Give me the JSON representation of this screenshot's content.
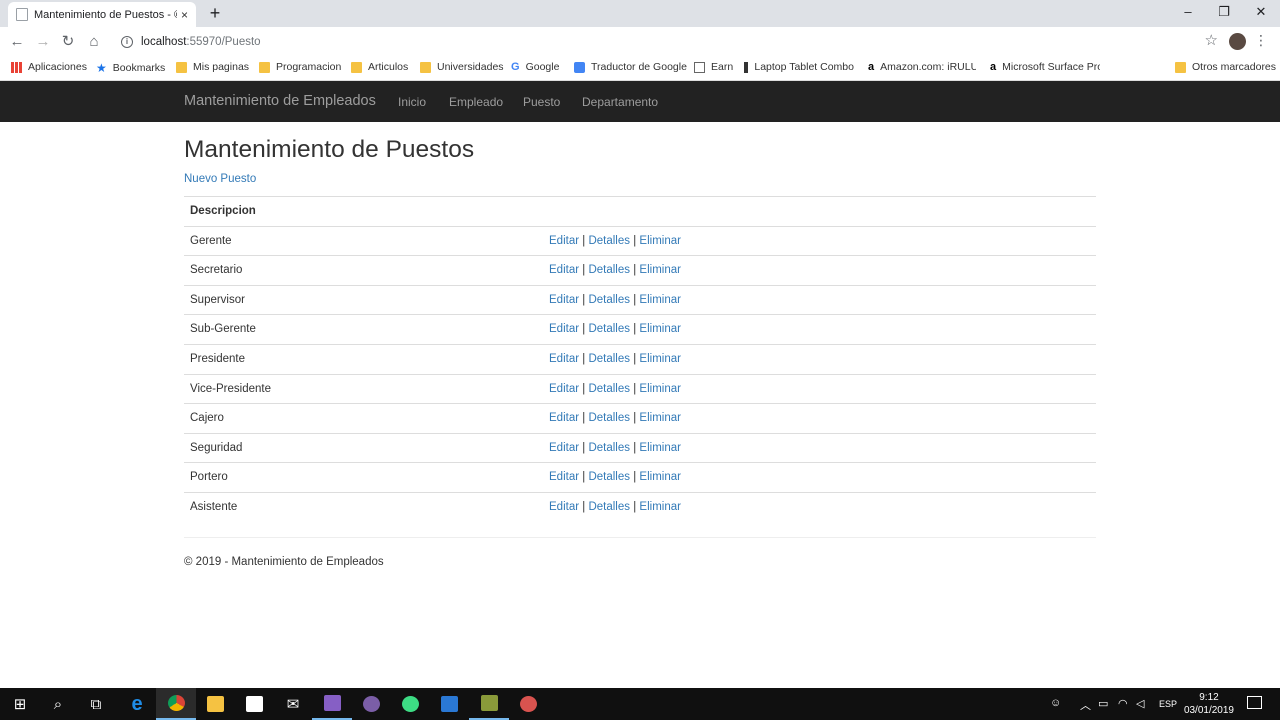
{
  "browser": {
    "tab_title": "Mantenimiento de Puestos - © 2",
    "tab_close": "×",
    "new_tab": "+",
    "url_host": "localhost",
    "url_rest": ":55970/Puesto",
    "window_controls": {
      "minimize": "–",
      "restore": "❐",
      "close": "✕"
    },
    "toolbar": {
      "back": "←",
      "forward": "→",
      "reload": "↻",
      "home": "⌂",
      "bookmark_star": "☆",
      "menu": "⋮"
    },
    "bookmarks": [
      {
        "label": "Aplicaciones",
        "icon": "apps-icon"
      },
      {
        "label": "Bookmarks",
        "icon": "star-icon"
      },
      {
        "label": "Mis paginas",
        "icon": "folder-icon"
      },
      {
        "label": "Programacion",
        "icon": "folder-icon"
      },
      {
        "label": "Articulos",
        "icon": "folder-icon"
      },
      {
        "label": "Universidades",
        "icon": "folder-icon"
      },
      {
        "label": "Google",
        "icon": "google-icon"
      },
      {
        "label": "Traductor de Google",
        "icon": "translate-icon"
      },
      {
        "label": "Earn",
        "icon": "page-icon"
      },
      {
        "label": "Laptop Tablet Combo",
        "icon": "laptop-icon"
      },
      {
        "label": "Amazon.com: iRULU",
        "icon": "amazon-icon"
      },
      {
        "label": "Microsoft Surface Pro",
        "icon": "amazon-icon"
      },
      {
        "label": "Otros marcadores",
        "icon": "folder-icon"
      }
    ]
  },
  "navbar": {
    "brand": "Mantenimiento de Empleados",
    "links": [
      "Inicio",
      "Empleado",
      "Puesto",
      "Departamento"
    ]
  },
  "page": {
    "title": "Mantenimiento de Puestos",
    "create_link": "Nuevo Puesto",
    "column_header": "Descripcion",
    "action_labels": {
      "edit": "Editar",
      "details": "Detalles",
      "delete": "Eliminar",
      "separator": "|"
    },
    "rows": [
      "Gerente",
      "Secretario",
      "Supervisor",
      "Sub-Gerente",
      "Presidente",
      "Vice-Presidente",
      "Cajero",
      "Seguridad",
      "Portero",
      "Asistente"
    ],
    "footer": "© 2019 - Mantenimiento de Empleados"
  },
  "taskbar": {
    "tray_lang": "ESP",
    "time": "9:12",
    "date": "03/01/2019"
  },
  "colors": {
    "link": "#337ab7",
    "navbar_bg": "#222222",
    "navbar_text": "#9d9d9d",
    "taskbar_bg": "#101010"
  }
}
